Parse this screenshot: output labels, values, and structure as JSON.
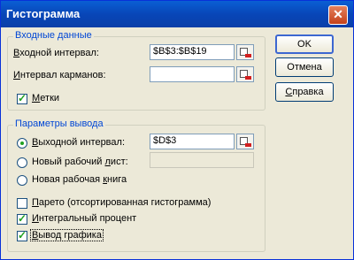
{
  "window": {
    "title": "Гистограмма",
    "close_glyph": "✕"
  },
  "input_group": {
    "title": "Входные данные",
    "input_range": {
      "label_prefix": "",
      "label_u": "В",
      "label_rest": "ходной интервал:",
      "value": "$B$3:$B$19"
    },
    "bin_range": {
      "label_u": "И",
      "label_rest": "нтервал карманов:",
      "value": ""
    },
    "labels": {
      "label_u": "М",
      "label_rest": "етки",
      "checked": true
    }
  },
  "output_group": {
    "title": "Параметры вывода",
    "output_range": {
      "label_u": "В",
      "label_rest": "ыходной интервал:",
      "value": "$D$3",
      "selected": true
    },
    "new_sheet": {
      "label_a": "Новый рабочий ",
      "label_u": "л",
      "label_b": "ист:",
      "value": ""
    },
    "new_workbook": {
      "label_a": "Новая рабочая ",
      "label_u": "к",
      "label_b": "нига"
    },
    "pareto": {
      "label_u": "П",
      "label_rest": "арето (отсортированная гистограмма)",
      "checked": false
    },
    "cumulative": {
      "label_u": "И",
      "label_rest": "нтегральный процент",
      "checked": true
    },
    "chart": {
      "label_u": "В",
      "label_rest": "ывод графика",
      "checked": true
    }
  },
  "buttons": {
    "ok": "OK",
    "cancel": "Отмена",
    "help_u": "С",
    "help_rest": "правка"
  }
}
